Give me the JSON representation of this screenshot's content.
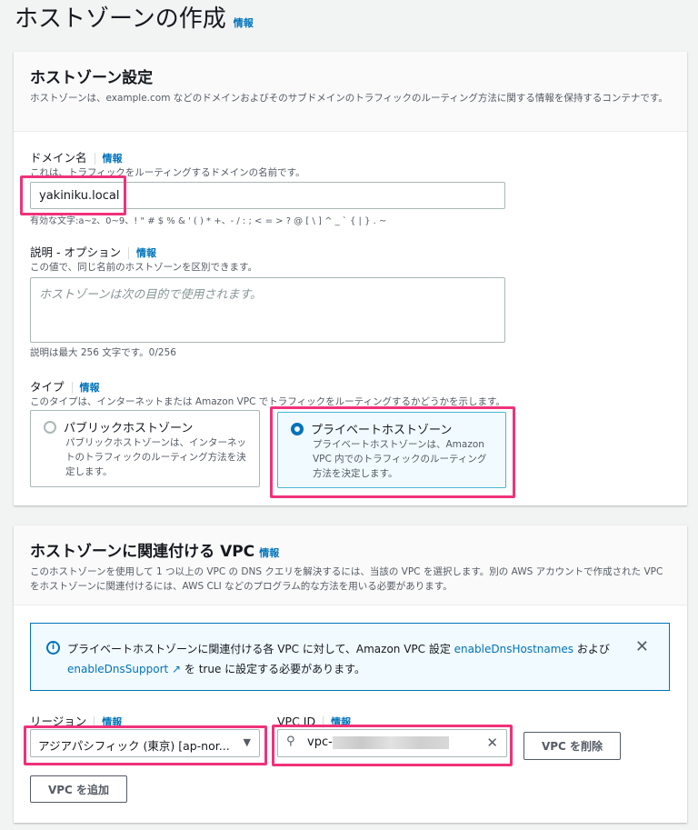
{
  "page": {
    "title": "ホストゾーンの作成",
    "info": "情報"
  },
  "settings": {
    "title": "ホストゾーン設定",
    "description": "ホストゾーンは、example.com などのドメインおよびそのサブドメインのトラフィックのルーティング方法に関する情報を保持するコンテナです。",
    "domain": {
      "label": "ドメイン名",
      "info": "情報",
      "hint": "これは、トラフィックをルーティングするドメインの名前です。",
      "value": "yakiniku.local",
      "constraint": "有効な文字:a~z、0~9、! \" # $ % & ' ( ) * +、- / : ; < = > ? @ [ \\ ] ^ _ ` { | } . ~"
    },
    "comment": {
      "label": "説明 - オプション",
      "info": "情報",
      "hint": "この値で、同じ名前のホストゾーンを区別できます。",
      "placeholder": "ホストゾーンは次の目的で使用されます。",
      "counter": "説明は最大 256 文字です。0/256"
    },
    "type": {
      "label": "タイプ",
      "info": "情報",
      "hint": "このタイプは、インターネットまたは Amazon VPC でトラフィックをルーティングするかどうかを示します。",
      "options": [
        {
          "label": "パブリックホストゾーン",
          "description": "パブリックホストゾーンは、インターネットのトラフィックのルーティング方法を決定します。",
          "selected": false
        },
        {
          "label": "プライベートホストゾーン",
          "description": "プライベートホストゾーンは、Amazon VPC 内でのトラフィックのルーティング方法を決定します。",
          "selected": true
        }
      ]
    }
  },
  "vpc": {
    "title": "ホストゾーンに関連付ける VPC",
    "info": "情報",
    "description": "このホストゾーンを使用して 1 つ以上の VPC の DNS クエリを解決するには、当該の VPC を選択します。別の AWS アカウントで作成された VPC をホストゾーンに関連付けるには、AWS CLI などのプログラム的な方法を用いる必要があります。",
    "alert": {
      "text1": "プライベートホストゾーンに関連付ける各 VPC に対して、Amazon VPC 設定 ",
      "link1": "enableDnsHostnames",
      "text2": " および ",
      "link2": "enableDnsSupport",
      "text3": " を true に設定する必要があります。"
    },
    "region": {
      "label": "リージョン",
      "info": "情報",
      "value": "アジアパシフィック (東京) [ap-nor..."
    },
    "vpc_id": {
      "label": "VPC ID",
      "info": "情報",
      "value": "vpc-"
    },
    "remove_button": "VPC を削除",
    "add_button": "VPC を追加"
  }
}
